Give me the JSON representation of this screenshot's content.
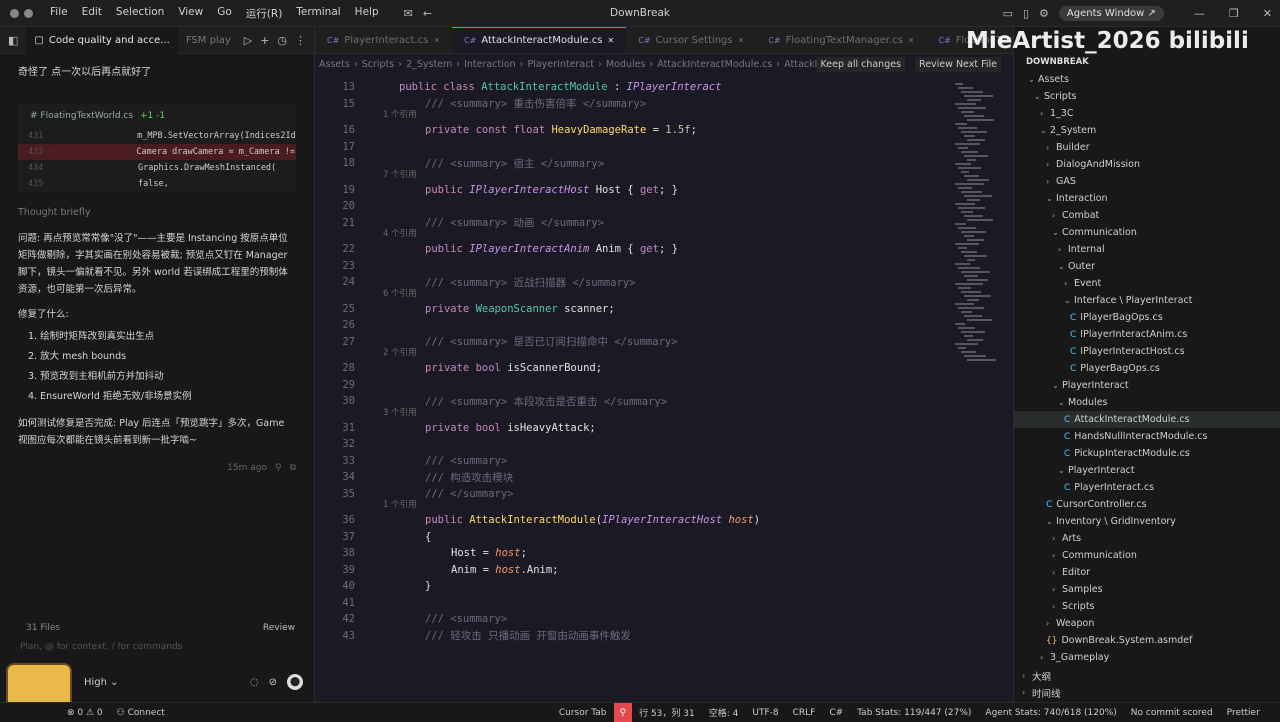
{
  "titlebar": {
    "menu": [
      "File",
      "Edit",
      "Selection",
      "View",
      "Go",
      "运行(R)",
      "Terminal",
      "Help"
    ],
    "title": "DownBreak",
    "agents_window": "Agents Window ↗"
  },
  "chat": {
    "tabs": [
      {
        "label": "Code quality and acce...",
        "active": true
      },
      {
        "label": "FSM play",
        "active": false
      }
    ],
    "user_message": "奇怪了 点一次以后再点就好了",
    "diff": {
      "file": "FloatingTextWorld.cs",
      "stats": "+1 -1",
      "lines": [
        {
          "ln": "431",
          "code": "m_MPB.SetVectorArray(Indices2Id,",
          "type": "ctx"
        },
        {
          "ln": "432 -",
          "code": "Camera drawCamera = m_Camera != r",
          "type": "del"
        },
        {
          "ln": "434",
          "code": "Graphics.DrawMeshInstanced(",
          "type": "ctx"
        },
        {
          "ln": "435",
          "code": "    false,",
          "type": "ctx"
        }
      ]
    },
    "thought": "Thought briefly",
    "problem": "问题: 再点预览常常像\"没了\"——主要是 Instancing 按原点单位矩阵做剔除，字其实画在别处容易被裁; 预览点又钉在 Manager 脚下，镜头一偏就看不见。另外 world 若误绑成工程里的预制体资源，也可能第一次后异常。",
    "fixed_heading": "修复了什么:",
    "fixes": [
      "1. 绘制时矩阵改到真实出生点",
      "2. 放大 mesh bounds",
      "3. 预览改到主相机前方并加抖动",
      "4. EnsureWorld 拒绝无效/非场景实例"
    ],
    "verify": "如何测试修复是否完成: Play 后连点「预览跳字」多次，Game 视图应每次都能在镜头前看到新一批字啮~",
    "timestamp": "15m ago",
    "files_count": "31 Files",
    "review": "Review",
    "placeholder": "Plan, @ for context, / for commands",
    "model": "High"
  },
  "editor": {
    "tabs": [
      {
        "label": "PlayerInteract.cs",
        "active": false
      },
      {
        "label": "AttackInteractModule.cs",
        "active": true
      },
      {
        "label": "Cursor Settings",
        "active": false
      },
      {
        "label": "FloatingTextManager.cs",
        "active": false
      },
      {
        "label": "FloatingTextWorld.cs",
        "active": false
      }
    ],
    "breadcrumb": [
      "Assets",
      "Scripts",
      "2_System",
      "Interaction",
      "PlayerInteract",
      "Modules",
      "AttackInteractModule.cs",
      "AttackInteractModule"
    ],
    "keep_all": "Keep all changes",
    "review_next": "Review Next File"
  },
  "statusbar": {
    "errors": "⊗ 0 ⚠ 0",
    "connect": "Connect",
    "cursor_tab": "Cursor Tab",
    "position": "行 53，列 31",
    "spaces": "空格: 4",
    "encoding": "UTF-8",
    "eol": "CRLF",
    "language": "C#",
    "tab_stats": "Tab Stats: 119/447 (27%)",
    "agent_stats": "Agent Stats: 740/618 (120%)",
    "commit": "No commit scored",
    "prettier": "Prettier"
  },
  "explorer": {
    "root": "DOWNBREAK",
    "outline": "大纲",
    "timeline": "时间线",
    "items": [
      {
        "label": "Assets",
        "depth": 1,
        "type": "folder-open"
      },
      {
        "label": "Scripts",
        "depth": 2,
        "type": "folder-open"
      },
      {
        "label": "1_3C",
        "depth": 3,
        "type": "folder"
      },
      {
        "label": "2_System",
        "depth": 3,
        "type": "folder-open"
      },
      {
        "label": "Builder",
        "depth": 4,
        "type": "folder"
      },
      {
        "label": "DialogAndMission",
        "depth": 4,
        "type": "folder"
      },
      {
        "label": "GAS",
        "depth": 4,
        "type": "folder"
      },
      {
        "label": "Interaction",
        "depth": 4,
        "type": "folder-open"
      },
      {
        "label": "Combat",
        "depth": 5,
        "type": "folder"
      },
      {
        "label": "Communication",
        "depth": 5,
        "type": "folder-open"
      },
      {
        "label": "Internal",
        "depth": 6,
        "type": "folder"
      },
      {
        "label": "Outer",
        "depth": 6,
        "type": "folder-open"
      },
      {
        "label": "Event",
        "depth": 7,
        "type": "folder"
      },
      {
        "label": "Interface \\ PlayerInteract",
        "depth": 7,
        "type": "folder-open"
      },
      {
        "label": "IPlayerBagOps.cs",
        "depth": 8,
        "type": "file"
      },
      {
        "label": "IPlayerInteractAnim.cs",
        "depth": 8,
        "type": "file"
      },
      {
        "label": "IPlayerInteractHost.cs",
        "depth": 8,
        "type": "file"
      },
      {
        "label": "PlayerBagOps.cs",
        "depth": 8,
        "type": "file"
      },
      {
        "label": "PlayerInteract",
        "depth": 5,
        "type": "folder-open"
      },
      {
        "label": "Modules",
        "depth": 6,
        "type": "folder-open"
      },
      {
        "label": "AttackInteractModule.cs",
        "depth": 7,
        "type": "file",
        "selected": true
      },
      {
        "label": "HandsNullInteractModule.cs",
        "depth": 7,
        "type": "file"
      },
      {
        "label": "PickupInteractModule.cs",
        "depth": 7,
        "type": "file"
      },
      {
        "label": "PlayerInteract",
        "depth": 6,
        "type": "folder-open"
      },
      {
        "label": "PlayerInteract.cs",
        "depth": 7,
        "type": "file"
      },
      {
        "label": "CursorController.cs",
        "depth": 4,
        "type": "file"
      },
      {
        "label": "Inventory \\ GridInventory",
        "depth": 4,
        "type": "folder-open"
      },
      {
        "label": "Arts",
        "depth": 5,
        "type": "folder"
      },
      {
        "label": "Communication",
        "depth": 5,
        "type": "folder"
      },
      {
        "label": "Editor",
        "depth": 5,
        "type": "folder"
      },
      {
        "label": "Samples",
        "depth": 5,
        "type": "folder"
      },
      {
        "label": "Scripts",
        "depth": 5,
        "type": "folder"
      },
      {
        "label": "Weapon",
        "depth": 4,
        "type": "folder"
      },
      {
        "label": "DownBreak.System.asmdef",
        "depth": 4,
        "type": "json"
      },
      {
        "label": "3_Gameplay",
        "depth": 3,
        "type": "folder"
      }
    ]
  },
  "watermark": "MieArtist_2026  bilibili",
  "code_lines": [
    {
      "ln": "13",
      "html": "<span class='kw'>public</span> <span class='kw'>class</span> <span class='ty'>AttackInteractModule</span> <span class='pl'>:</span> <span class='tyi'>IPlayerInteract</span>",
      "indent": 0
    },
    {
      "ln": "15",
      "html": "<span class='cm'>/// &lt;summary&gt; 重击伤害倍率 &lt;/summary&gt;</span>",
      "indent": 1
    },
    {
      "hint": "1 个引用"
    },
    {
      "ln": "16",
      "html": "<span class='kw'>private</span> <span class='kw'>const</span> <span class='kw'>float</span> <span class='fn'>HeavyDamageRate</span> <span class='pl'>=</span> <span class='num'>1.5f</span><span class='pl'>;</span>",
      "indent": 1
    },
    {
      "ln": "17",
      "html": "",
      "indent": 1
    },
    {
      "ln": "18",
      "html": "<span class='cm'>/// &lt;summary&gt; 宿主 &lt;/summary&gt;</span>",
      "indent": 1
    },
    {
      "hint": "7 个引用"
    },
    {
      "ln": "19",
      "html": "<span class='kw'>public</span> <span class='tyi'>IPlayerInteractHost</span> <span class='pl'>Host { </span><span class='kw'>get</span><span class='pl'>; }</span>",
      "indent": 1
    },
    {
      "ln": "20",
      "html": "",
      "indent": 1
    },
    {
      "ln": "21",
      "html": "<span class='cm'>/// &lt;summary&gt; 动画 &lt;/summary&gt;</span>",
      "indent": 1
    },
    {
      "hint": "4 个引用"
    },
    {
      "ln": "22",
      "html": "<span class='kw'>public</span> <span class='tyi'>IPlayerInteractAnim</span> <span class='pl'>Anim { </span><span class='kw'>get</span><span class='pl'>; }</span>",
      "indent": 1
    },
    {
      "ln": "23",
      "html": "",
      "indent": 1
    },
    {
      "ln": "24",
      "html": "<span class='cm'>/// &lt;summary&gt; 近战扫描器 &lt;/summary&gt;</span>",
      "indent": 1
    },
    {
      "hint": "6 个引用"
    },
    {
      "ln": "25",
      "html": "<span class='kw'>private</span> <span class='ty'>WeaponScanner</span> <span class='pl'>scanner;</span>",
      "indent": 1
    },
    {
      "ln": "26",
      "html": "",
      "indent": 1
    },
    {
      "ln": "27",
      "html": "<span class='cm'>/// &lt;summary&gt; 是否已订阅扫描命中 &lt;/summary&gt;</span>",
      "indent": 1
    },
    {
      "hint": "2 个引用"
    },
    {
      "ln": "28",
      "html": "<span class='kw'>private</span> <span class='kw'>bool</span> <span class='pl'>isScannerBound;</span>",
      "indent": 1
    },
    {
      "ln": "29",
      "html": "",
      "indent": 1
    },
    {
      "ln": "30",
      "html": "<span class='cm'>/// &lt;summary&gt; 本段攻击是否重击 &lt;/summary&gt;</span>",
      "indent": 1
    },
    {
      "hint": "3 个引用"
    },
    {
      "ln": "31",
      "html": "<span class='kw'>private</span> <span class='kw'>bool</span> <span class='pl'>isHeavyAttack;</span>",
      "indent": 1
    },
    {
      "ln": "32",
      "html": "",
      "indent": 1
    },
    {
      "ln": "33",
      "html": "<span class='cm'>/// &lt;summary&gt;</span>",
      "indent": 1
    },
    {
      "ln": "34",
      "html": "<span class='cm'>/// 构造攻击模块</span>",
      "indent": 1
    },
    {
      "ln": "35",
      "html": "<span class='cm'>/// &lt;/summary&gt;</span>",
      "indent": 1
    },
    {
      "hint": "1 个引用"
    },
    {
      "ln": "36",
      "html": "<span class='kw'>public</span> <span class='fn'>AttackInteractModule</span><span class='pl'>(</span><span class='tyi'>IPlayerInteractHost</span> <span class='pm'>host</span><span class='pl'>)</span>",
      "indent": 1
    },
    {
      "ln": "37",
      "html": "<span class='pl'>{</span>",
      "indent": 1
    },
    {
      "ln": "38",
      "html": "<span class='pl'>Host = </span><span class='pm'>host</span><span class='pl'>;</span>",
      "indent": 2
    },
    {
      "ln": "39",
      "html": "<span class='pl'>Anim = </span><span class='pm'>host</span><span class='pl'>.Anim;</span>",
      "indent": 2
    },
    {
      "ln": "40",
      "html": "<span class='pl'>}</span>",
      "indent": 1
    },
    {
      "ln": "41",
      "html": "",
      "indent": 1
    },
    {
      "ln": "42",
      "html": "<span class='cm'>/// &lt;summary&gt;</span>",
      "indent": 1
    },
    {
      "ln": "43",
      "html": "<span class='cm'>/// 轻攻击 只播动画 开窗由动画事件触发</span>",
      "indent": 1
    }
  ]
}
